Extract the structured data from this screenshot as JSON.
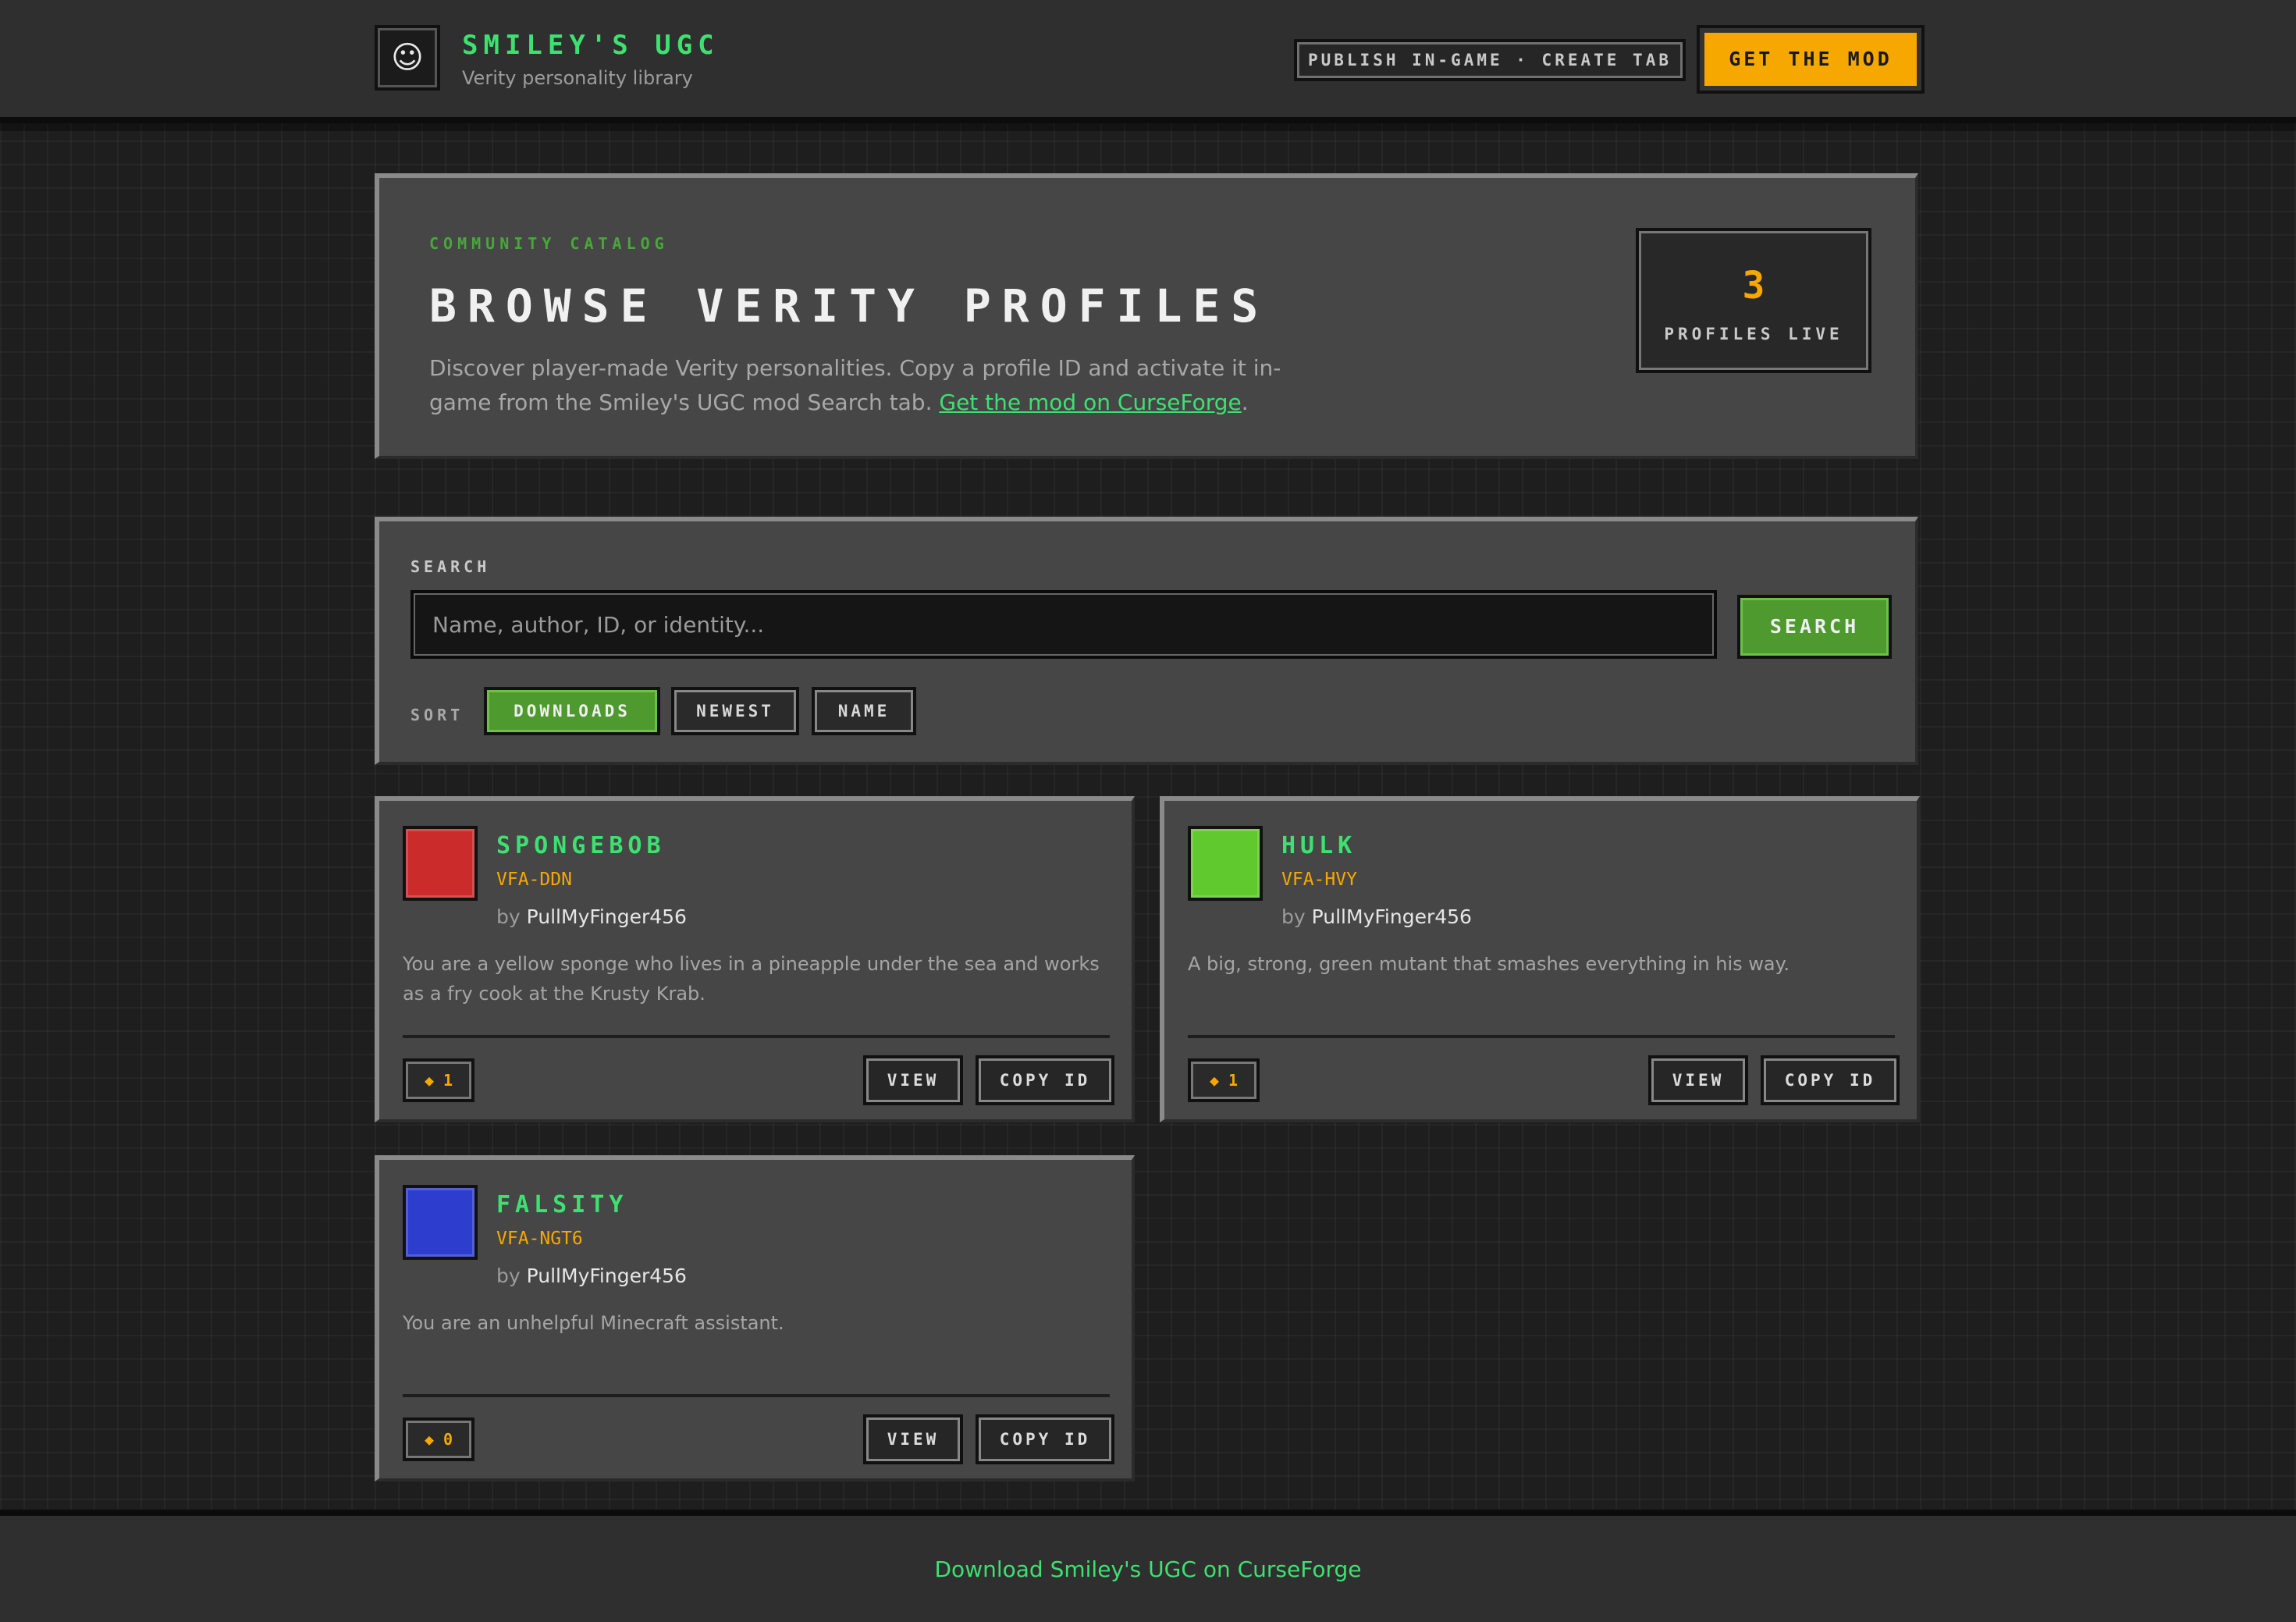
{
  "header": {
    "logo_glyph": "☺",
    "brand_title": "SMILEY'S UGC",
    "brand_subtitle": "Verity personality library",
    "publish_label": "PUBLISH IN-GAME · CREATE TAB",
    "get_mod_label": "GET THE MOD"
  },
  "hero": {
    "eyebrow": "COMMUNITY CATALOG",
    "title": "BROWSE VERITY PROFILES",
    "description_text": "Discover player-made Verity personalities. Copy a profile ID and activate it in-game from the Smiley's UGC mod Search tab. ",
    "description_link": "Get the mod on CurseForge",
    "description_end": ".",
    "stat_value": "3",
    "stat_label": "PROFILES LIVE"
  },
  "search": {
    "label": "SEARCH",
    "placeholder": "Name, author, ID, or identity...",
    "value": "",
    "button_label": "SEARCH",
    "sort_label": "SORT",
    "sort_options": [
      "DOWNLOADS",
      "NEWEST",
      "NAME"
    ],
    "active_sort": "DOWNLOADS"
  },
  "profiles": [
    {
      "name": "SPONGEBOB",
      "id": "VFA-DDN",
      "by": "by",
      "author": "PullMyFinger456",
      "description": "You are a yellow sponge who lives in a pineapple under the sea and works as a fry cook at the Krusty Krab.",
      "downloads": "◆ 1",
      "color": "#cc2b2b",
      "view_label": "VIEW",
      "copy_label": "COPY ID"
    },
    {
      "name": "HULK",
      "id": "VFA-HVY",
      "by": "by",
      "author": "PullMyFinger456",
      "description": "A big, strong, green mutant that smashes everything in his way.",
      "downloads": "◆ 1",
      "color": "#5fc92e",
      "view_label": "VIEW",
      "copy_label": "COPY ID"
    },
    {
      "name": "FALSITY",
      "id": "VFA-NGT6",
      "by": "by",
      "author": "PullMyFinger456",
      "description": "You are an unhelpful Minecraft assistant.",
      "downloads": "◆ 0",
      "color": "#2d3ecf",
      "view_label": "VIEW",
      "copy_label": "COPY ID"
    }
  ],
  "footer": {
    "link_label": "Download Smiley's UGC on CurseForge"
  },
  "colors": {
    "accent_green": "#3ee070",
    "accent_orange": "#f7a800",
    "button_green": "#4e9a2e",
    "panel": "#464646"
  }
}
